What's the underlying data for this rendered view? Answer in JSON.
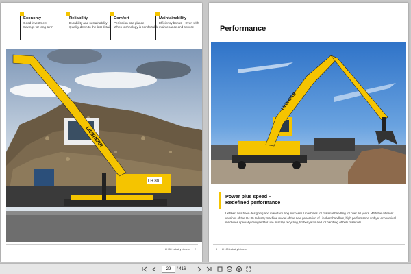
{
  "left_page": {
    "features": [
      {
        "title": "Economy",
        "lines": [
          "Good investment –",
          "Savings for long-term"
        ]
      },
      {
        "title": "Reliability",
        "lines": [
          "Durability and sustainability –",
          "Quality down to the last detail"
        ]
      },
      {
        "title": "Comfort",
        "lines": [
          "Perfection at a glance –",
          "When technology is comfortable"
        ]
      },
      {
        "title": "Maintainability",
        "lines": [
          "Efficiency bonus – Even with",
          "maintenance and service"
        ]
      }
    ],
    "footer": "LH 80 Industry Litronic",
    "page_number": "2",
    "machine_brand": "LIEBHERR",
    "machine_model": "LH 80"
  },
  "right_page": {
    "title": "Performance",
    "subheading_line1": "Power plus speed –",
    "subheading_line2": "Redefined performance",
    "body": "Liebherr has been designing and manufacturing successful machines for material handling for over 50 years. With the different versions of the LH 80 Industry machine model of the new generation of Liebherr handlers, high performance and yet economical machines specially designed for use in scrap recycling, timber yards and for handling of bulk materials.",
    "page_number": "3",
    "footer": "LH 80 Industry Litronic",
    "machine_brand": "LIEBHERR"
  },
  "toolbar": {
    "current_page": "29",
    "total_pages": "/ 416"
  },
  "colors": {
    "accent": "#f5c400",
    "icon_yellow": "#f5c400"
  }
}
